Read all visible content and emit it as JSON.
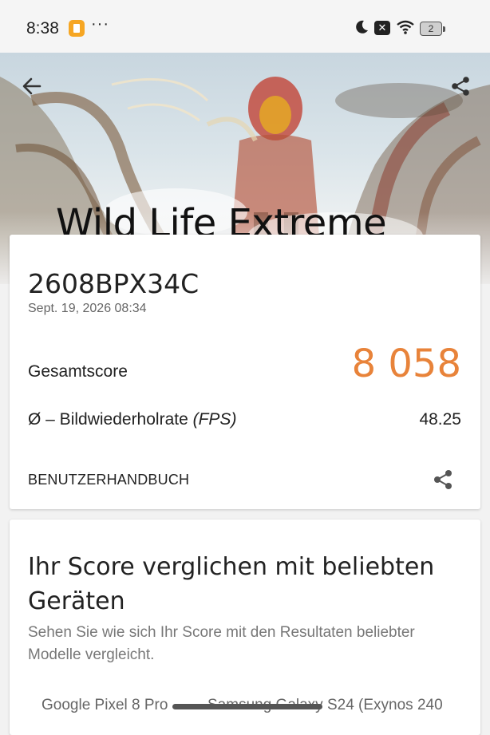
{
  "status_bar": {
    "time": "8:38",
    "more": "···",
    "battery": "2"
  },
  "hero": {
    "title": "Wild Life Extreme"
  },
  "result": {
    "device": "2608BPX34C",
    "date": "Sept. 19, 2026 08:34",
    "score_label": "Gesamtscore",
    "score_value": "8 058",
    "fps_label_prefix": "Ø – Bildwiederholrate ",
    "fps_label_unit": "(FPS)",
    "fps_value": "48.25",
    "manual_label": "BENUTZERHANDBUCH"
  },
  "compare": {
    "title": "Ihr Score verglichen mit beliebten Geräten",
    "description": "Sehen Sie wie sich Ihr Score mit den Resultaten beliebter Modelle vergleicht.",
    "devices": [
      "Google Pixel 8 Pro",
      "Samsung Galaxy S24 (Exynos 240"
    ]
  },
  "colors": {
    "accent": "#e8833a"
  },
  "icons": [
    "back-arrow-icon",
    "share-icon",
    "moon-icon",
    "notification-x-icon",
    "wifi-icon",
    "battery-icon"
  ]
}
